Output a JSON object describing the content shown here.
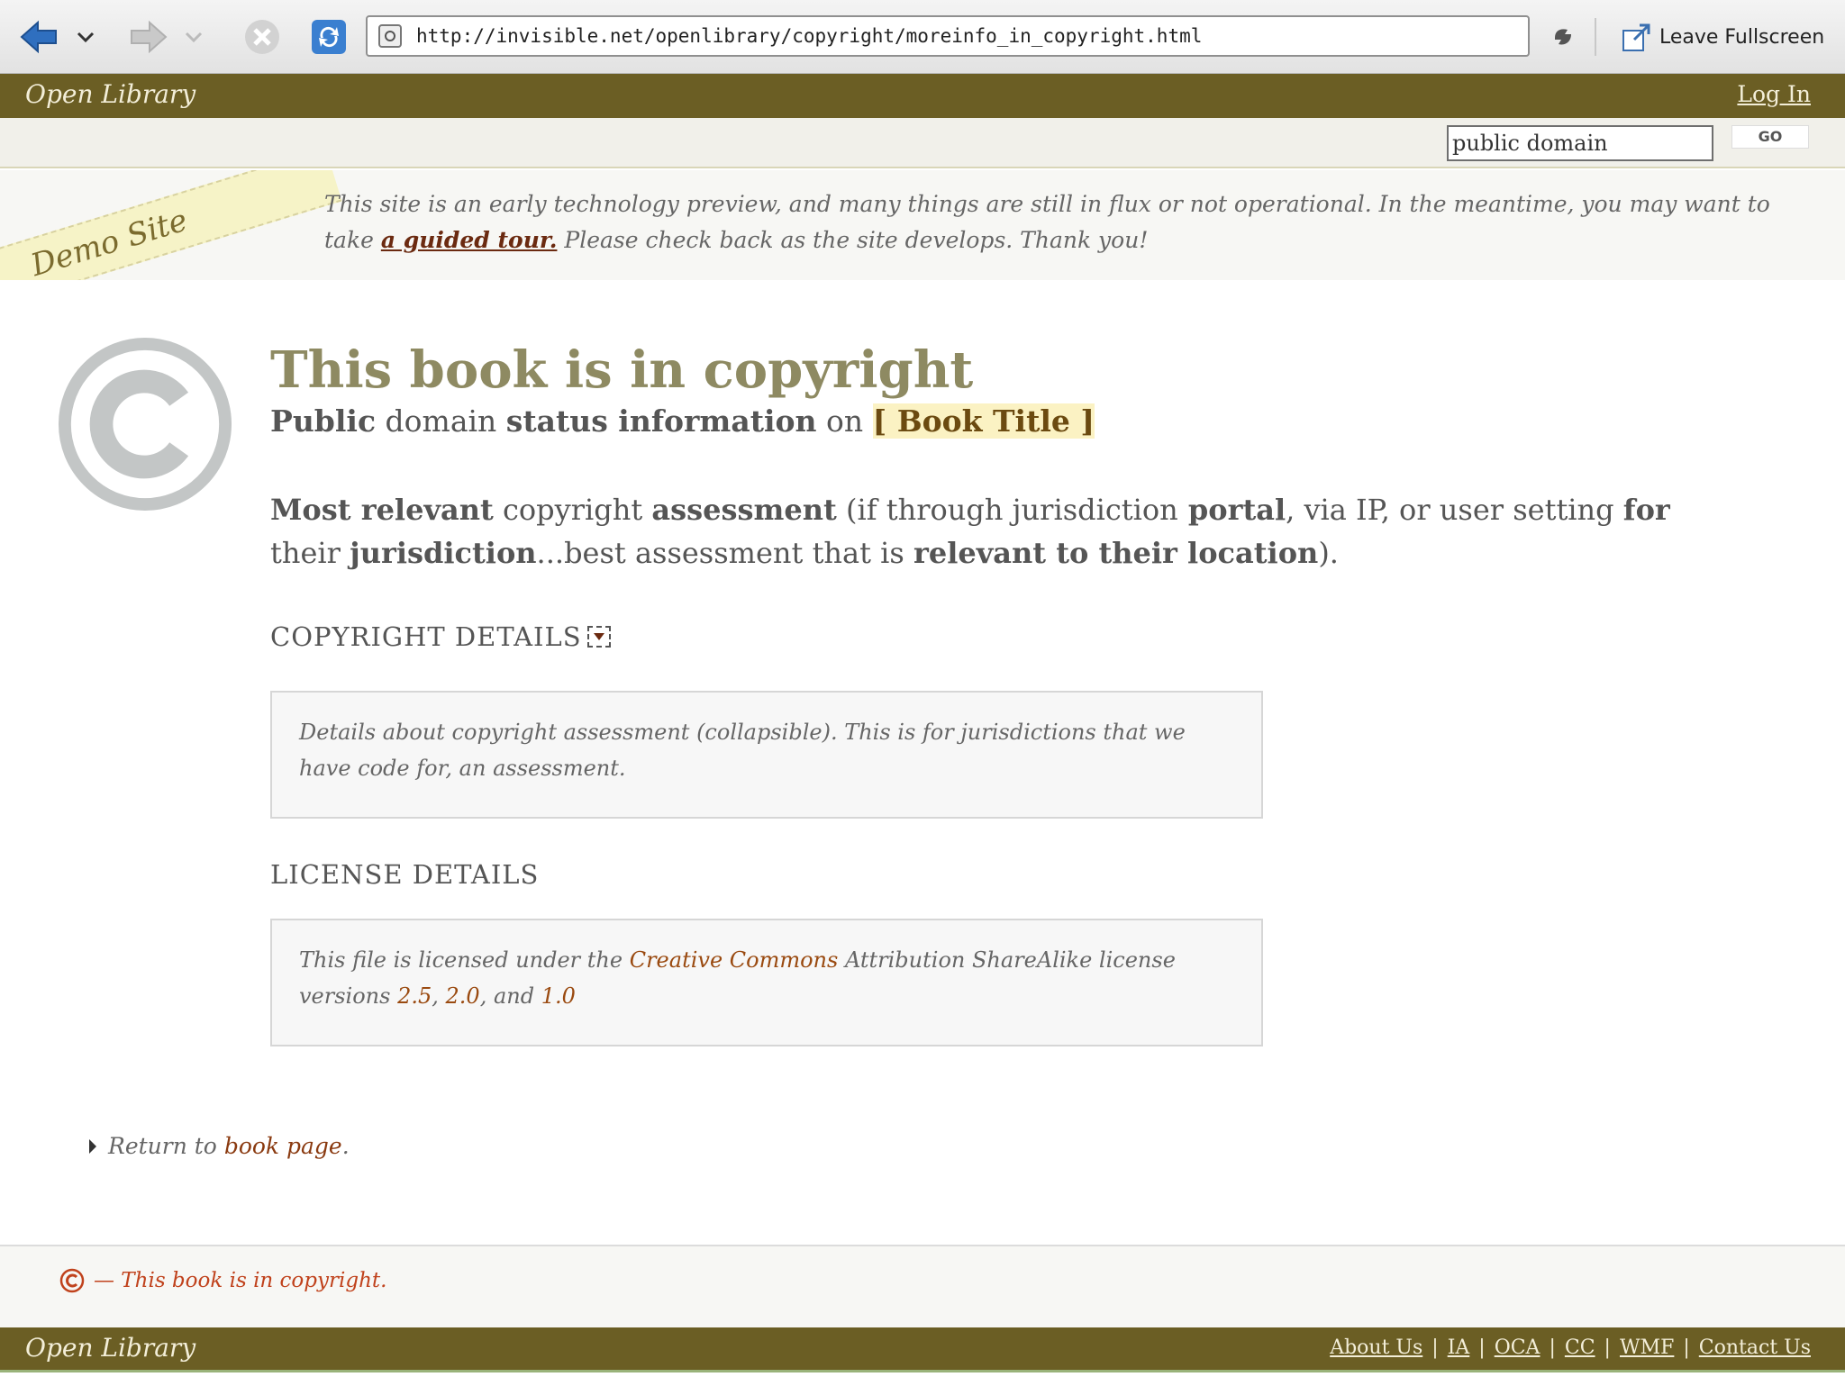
{
  "browser": {
    "url": "http://invisible.net/openlibrary/copyright/moreinfo_in_copyright.html",
    "fullscreen_label": "Leave Fullscreen"
  },
  "header": {
    "brand": "Open Library",
    "login": "Log In"
  },
  "search": {
    "value": "public domain",
    "go_label": "GO"
  },
  "demo": {
    "ribbon": "Demo Site",
    "text_before": "This site is an early technology preview, and many things are still in flux or not operational. In the meantime, you may want to take ",
    "tour_link": "a guided tour.",
    "text_after": " Please check back as the site develops. Thank you!"
  },
  "main": {
    "title": "This book is in copyright",
    "subtitle_prefix_bold": "Public",
    "subtitle_mid1": " domain ",
    "subtitle_bold2": "status information",
    "subtitle_mid2": " on ",
    "book_title": "[ Book Title ]",
    "assessment_bold1": "Most relevant",
    "assessment_t1": " copyright ",
    "assessment_bold2": "assessment",
    "assessment_t2": " (if through ",
    "assessment_t3": "jurisdiction",
    "assessment_bold3": " portal",
    "assessment_t4": ", via IP, or user setting ",
    "assessment_bold4": "for",
    "assessment_t5": " their ",
    "assessment_bold5": "jurisdiction",
    "assessment_t6": "...best assessment that is ",
    "assessment_bold6": "relevant to their location",
    "assessment_t7": ")."
  },
  "copyright_details": {
    "heading": "COPYRIGHT DETAILS",
    "text": "Details about copyright assessment (collapsible). This is for jurisdictions that we have code for, an assessment."
  },
  "license_details": {
    "heading": "LICENSE DETAILS",
    "t1": "This file",
    "t2": " is licensed under the ",
    "cc_link": "Creative Commons",
    "t3": " Attribution ShareAlike license versions ",
    "v1": "2.5",
    "t4": ", ",
    "v2": "2.0",
    "t5": ", and ",
    "v3": "1.0"
  },
  "return": {
    "prefix": "Return to ",
    "link": "book page",
    "suffix": "."
  },
  "footer": {
    "status": "— This book is in copyright.",
    "brand": "Open Library",
    "links": [
      "About Us",
      "IA",
      "OCA",
      "CC",
      "WMF",
      "Contact Us"
    ],
    "separator": "|"
  },
  "colors": {
    "header_bg": "#6b5e24",
    "title": "#8e8a62",
    "link_accent": "#9a4a10",
    "status_red": "#c0421c"
  }
}
